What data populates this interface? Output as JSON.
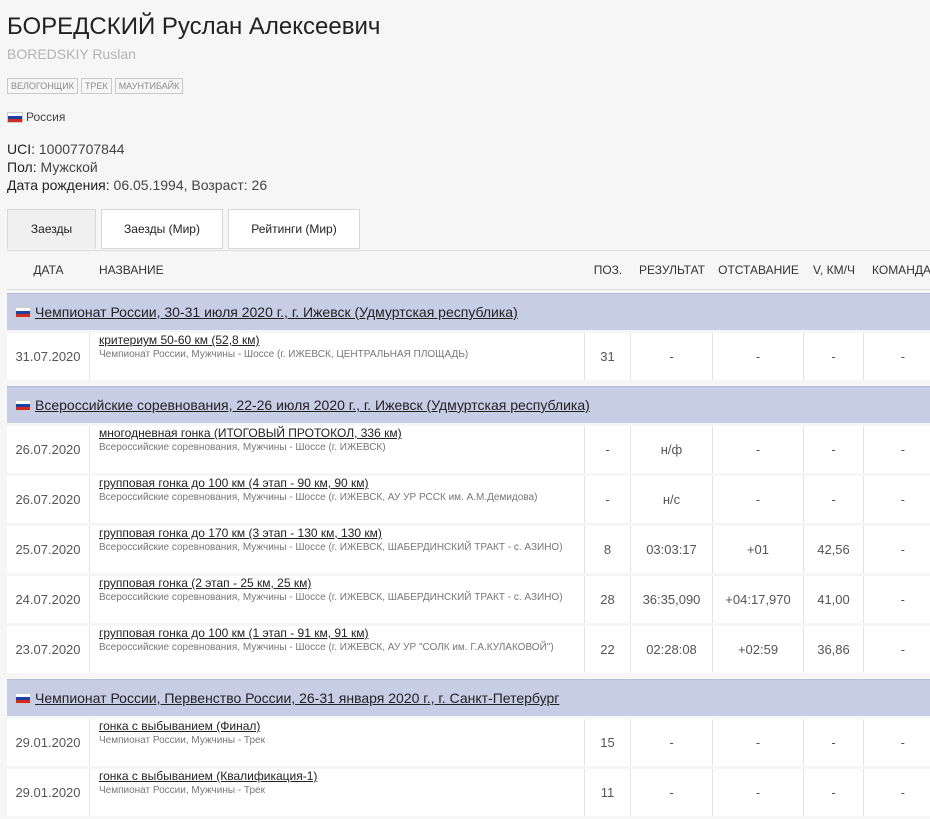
{
  "athlete": {
    "name": "БОРЕДСКИЙ Руслан Алексеевич",
    "latin_name": "BOREDSKIY Ruslan",
    "tags": [
      "ВЕЛОГОНЩИК",
      "ТРЕК",
      "МАУНТИБАЙК"
    ],
    "country": "Россия",
    "uci_label": "UCI:",
    "uci": "10007707844",
    "gender_label": "Пол:",
    "gender": "Мужской",
    "birth_label": "Дата рождения:",
    "birth": "06.05.1994, Возраст: 26"
  },
  "tabs": [
    "Заезды",
    "Заезды (Мир)",
    "Рейтинги (Мир)"
  ],
  "table": {
    "headers": [
      "ДАТА",
      "НАЗВАНИЕ",
      "ПОЗ.",
      "РЕЗУЛЬТАТ",
      "ОТСТАВАНИЕ",
      "V, КМ/Ч",
      "КОМАНДА"
    ],
    "groups": [
      {
        "title": "Чемпионат России, 30-31 июля 2020 г., г. Ижевск (Удмуртская республика)",
        "rows": [
          {
            "date": "31.07.2020",
            "race": "критериум 50-60 км (52,8 км)",
            "sub": "Чемпионат России, Мужчины - Шоссе (г. ИЖЕВСК, ЦЕНТРАЛЬНАЯ ПЛОЩАДЬ)",
            "pos": "31",
            "res": "-",
            "gap": "-",
            "spd": "-",
            "team": "-"
          }
        ]
      },
      {
        "title": "Всероссийские соревнования, 22-26 июля 2020 г., г. Ижевск (Удмуртская республика)",
        "rows": [
          {
            "date": "26.07.2020",
            "race": "многодневная гонка (ИТОГОВЫЙ ПРОТОКОЛ, 336 км)",
            "sub": "Всероссийские соревнования, Мужчины - Шоссе (г. ИЖЕВСК)",
            "pos": "-",
            "res": "н/ф",
            "gap": "-",
            "spd": "-",
            "team": "-"
          },
          {
            "date": "26.07.2020",
            "race": "групповая гонка до 100 км (4 этап - 90 км, 90 км)",
            "sub": "Всероссийские соревнования, Мужчины - Шоссе (г. ИЖЕВСК, АУ УР РССК им. А.М.Демидова)",
            "pos": "-",
            "res": "н/с",
            "gap": "-",
            "spd": "-",
            "team": "-"
          },
          {
            "date": "25.07.2020",
            "race": "групповая гонка до 170 км (3 этап - 130 км, 130 км)",
            "sub": "Всероссийские соревнования, Мужчины - Шоссе (г. ИЖЕВСК, ШАБЕРДИНСКИЙ ТРАКТ - с. АЗИНО)",
            "pos": "8",
            "res": "03:03:17",
            "gap": "+01",
            "spd": "42,56",
            "team": "-"
          },
          {
            "date": "24.07.2020",
            "race": "групповая гонка (2 этап - 25 км, 25 км)",
            "sub": "Всероссийские соревнования, Мужчины - Шоссе (г. ИЖЕВСК, ШАБЕРДИНСКИЙ ТРАКТ - с. АЗИНО)",
            "pos": "28",
            "res": "36:35,090",
            "gap": "+04:17,970",
            "spd": "41,00",
            "team": "-"
          },
          {
            "date": "23.07.2020",
            "race": "групповая гонка до 100 км (1 этап - 91 км, 91 км)",
            "sub": "Всероссийские соревнования, Мужчины - Шоссе (г. ИЖЕВСК, АУ УР \"СОЛК им. Г.А.КУЛАКОВОЙ\")",
            "pos": "22",
            "res": "02:28:08",
            "gap": "+02:59",
            "spd": "36,86",
            "team": "-"
          }
        ]
      },
      {
        "title": "Чемпионат России, Первенство России, 26-31 января 2020 г., г. Санкт-Петербург",
        "rows": [
          {
            "date": "29.01.2020",
            "race": "гонка с выбыванием (Финал)",
            "sub": "Чемпионат России, Мужчины - Трек",
            "pos": "15",
            "res": "-",
            "gap": "-",
            "spd": "-",
            "team": "-"
          },
          {
            "date": "29.01.2020",
            "race": "гонка с выбыванием (Квалификация-1)",
            "sub": "Чемпионат России, Мужчины - Трек",
            "pos": "11",
            "res": "-",
            "gap": "-",
            "spd": "-",
            "team": "-"
          }
        ]
      }
    ]
  }
}
